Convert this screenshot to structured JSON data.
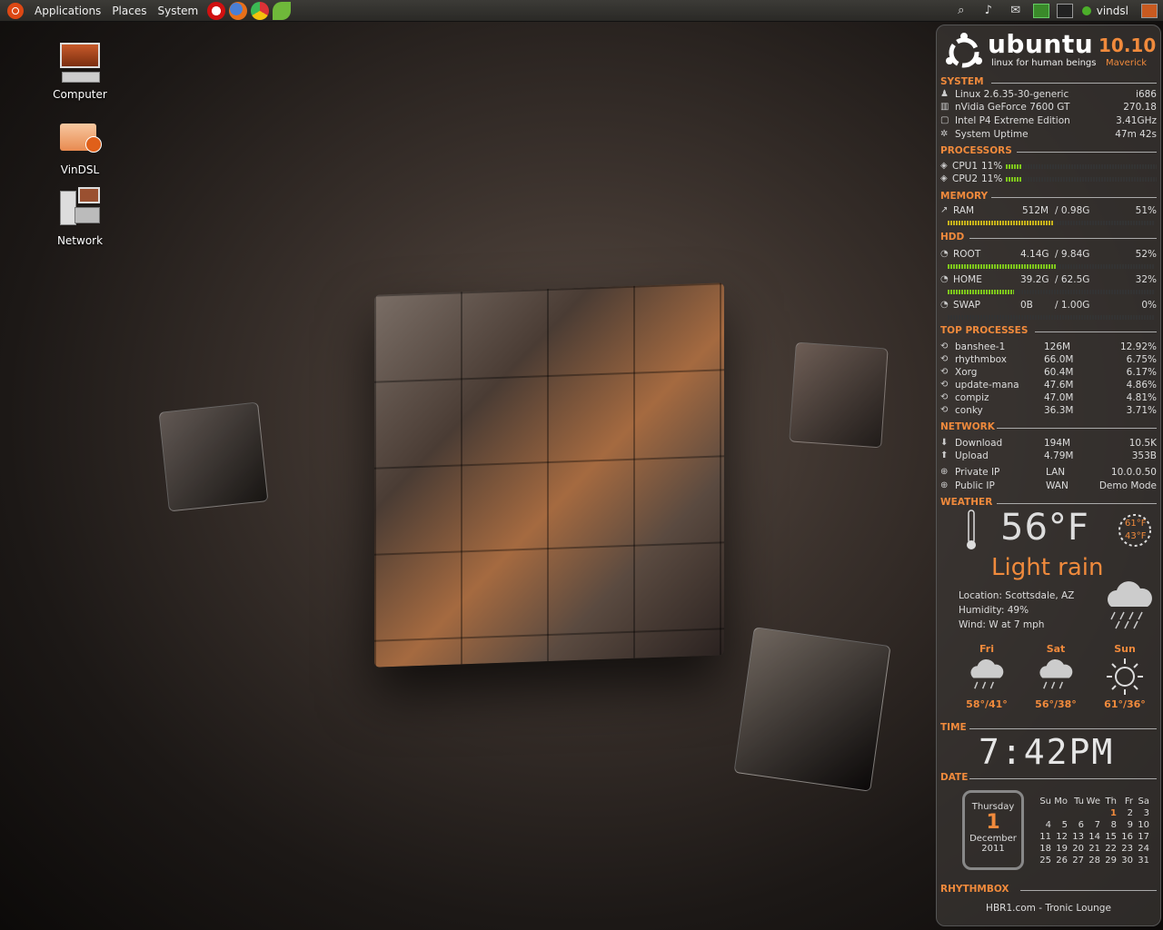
{
  "panel": {
    "menus": [
      "Applications",
      "Places",
      "System"
    ],
    "user": "vindsl"
  },
  "desktop": {
    "icons": [
      {
        "label": "Computer"
      },
      {
        "label": "VinDSL"
      },
      {
        "label": "Network"
      }
    ]
  },
  "conky": {
    "logo": {
      "brand": "ubuntu",
      "tagline": "linux for human beings",
      "version": "10.10",
      "codename": "Maverick"
    },
    "system": {
      "title": "SYSTEM",
      "rows": [
        {
          "label": "Linux 2.6.35-30-generic",
          "value": "i686"
        },
        {
          "label": "nVidia GeForce 7600 GT",
          "value": "270.18"
        },
        {
          "label": "Intel P4 Extreme Edition",
          "value": "3.41GHz"
        },
        {
          "label": "System Uptime",
          "value": "47m 42s"
        }
      ]
    },
    "processors": {
      "title": "PROCESSORS",
      "rows": [
        {
          "label": "CPU1",
          "pct": "11%",
          "fill": 0.11
        },
        {
          "label": "CPU2",
          "pct": "11%",
          "fill": 0.11
        }
      ]
    },
    "memory": {
      "title": "MEMORY",
      "label": "RAM",
      "used": "512M",
      "total": "/ 0.98G",
      "pct": "51%",
      "fill": 0.51
    },
    "hdd": {
      "title": "HDD",
      "rows": [
        {
          "label": "ROOT",
          "used": "4.14G",
          "total": "/ 9.84G",
          "pct": "52%",
          "fill": 0.52
        },
        {
          "label": "HOME",
          "used": "39.2G",
          "total": "/ 62.5G",
          "pct": "32%",
          "fill": 0.32
        },
        {
          "label": "SWAP",
          "used": "0B",
          "total": "/ 1.00G",
          "pct": "0%",
          "fill": 0.0
        }
      ]
    },
    "top": {
      "title": "TOP PROCESSES",
      "rows": [
        {
          "name": "banshee-1",
          "mem": "126M",
          "cpu": "12.92%"
        },
        {
          "name": "rhythmbox",
          "mem": "66.0M",
          "cpu": "6.75%"
        },
        {
          "name": "Xorg",
          "mem": "60.4M",
          "cpu": "6.17%"
        },
        {
          "name": "update-mana",
          "mem": "47.6M",
          "cpu": "4.86%"
        },
        {
          "name": "compiz",
          "mem": "47.0M",
          "cpu": "4.81%"
        },
        {
          "name": "conky",
          "mem": "36.3M",
          "cpu": "3.71%"
        }
      ]
    },
    "network": {
      "title": "NETWORK",
      "rows": [
        {
          "label": "Download",
          "total": "194M",
          "rate": "10.5K"
        },
        {
          "label": "Upload",
          "total": "4.79M",
          "rate": "353B"
        },
        {
          "label": "Private IP",
          "total": "LAN",
          "rate": "10.0.0.50"
        },
        {
          "label": "Public  IP",
          "total": "WAN",
          "rate": "Demo Mode"
        }
      ]
    },
    "weather": {
      "title": "WEATHER",
      "temp": "56°F",
      "high": "61°F",
      "low": "43°F",
      "condition": "Light rain",
      "location": "Location: Scottsdale, AZ",
      "humidity": "Humidity: 49%",
      "wind": "Wind: W at 7 mph",
      "forecast": [
        {
          "day": "Fri",
          "temps": "58°/41°",
          "icon": "rain-cloud-icon"
        },
        {
          "day": "Sat",
          "temps": "56°/38°",
          "icon": "rain-cloud-icon"
        },
        {
          "day": "Sun",
          "temps": "61°/36°",
          "icon": "sun-icon"
        }
      ]
    },
    "time": {
      "title": "TIME",
      "value": "7:42PM"
    },
    "date": {
      "title": "DATE",
      "weekday": "Thursday",
      "day": "1",
      "month": "December",
      "year": "2011",
      "cal_head": [
        "Su",
        "Mo",
        "Tu",
        "We",
        "Th",
        "Fr",
        "Sa"
      ],
      "cal_rows": [
        [
          "",
          "",
          "",
          "",
          "1",
          "2",
          "3"
        ],
        [
          "4",
          "5",
          "6",
          "7",
          "8",
          "9",
          "10"
        ],
        [
          "11",
          "12",
          "13",
          "14",
          "15",
          "16",
          "17"
        ],
        [
          "18",
          "19",
          "20",
          "21",
          "22",
          "23",
          "24"
        ],
        [
          "25",
          "26",
          "27",
          "28",
          "29",
          "30",
          "31"
        ]
      ]
    },
    "rhythmbox": {
      "title": "RHYTHMBOX",
      "track": "HBR1.com - Tronic Lounge"
    }
  },
  "colors": {
    "accent": "#f08a3c",
    "bar_fill": "#7ec81c"
  }
}
